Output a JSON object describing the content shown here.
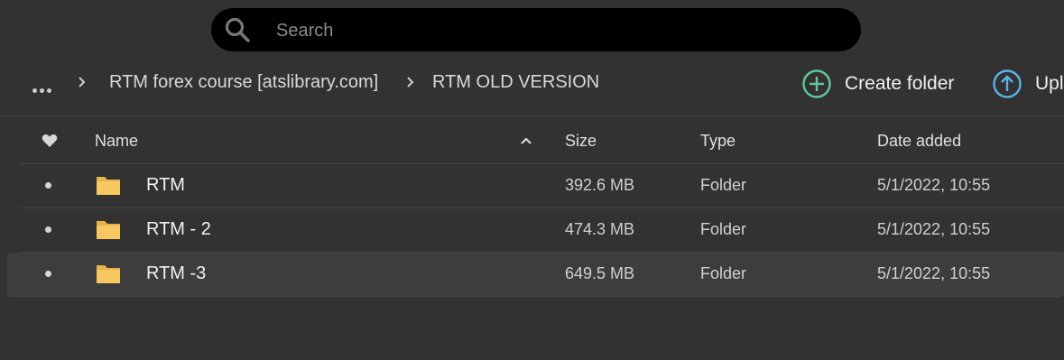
{
  "search": {
    "placeholder": "Search",
    "value": ""
  },
  "breadcrumb": {
    "more_icon": "ellipsis-icon",
    "items": [
      "RTM forex course [atslibrary.com]",
      "RTM OLD VERSION"
    ]
  },
  "actions": {
    "create_folder": "Create folder",
    "upload": "Upl"
  },
  "colors": {
    "create_accent": "#5ec99a",
    "upload_accent": "#5ab4e6",
    "folder": "#f6c85f"
  },
  "table": {
    "headers": {
      "name": "Name",
      "size": "Size",
      "type": "Type",
      "date": "Date added"
    },
    "rows": [
      {
        "name": "RTM",
        "size": "392.6 MB",
        "type": "Folder",
        "date": "5/1/2022, 10:55"
      },
      {
        "name": "RTM - 2",
        "size": "474.3 MB",
        "type": "Folder",
        "date": "5/1/2022, 10:55"
      },
      {
        "name": "RTM -3",
        "size": "649.5 MB",
        "type": "Folder",
        "date": "5/1/2022, 10:55"
      }
    ]
  }
}
